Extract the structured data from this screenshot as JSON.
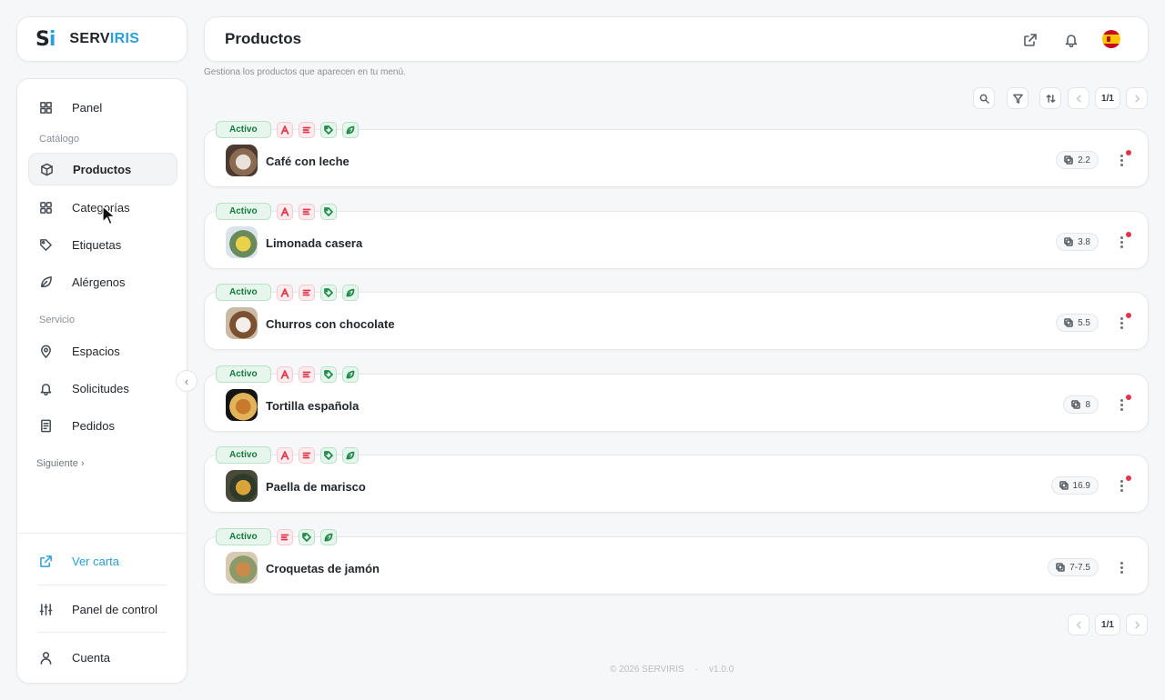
{
  "brand": {
    "mark_s": "S",
    "mark_i": "i",
    "name_a": "SERV",
    "name_b": "IRIS"
  },
  "sidebar": {
    "panel_label": "Panel",
    "catalog_section": "Catálogo",
    "catalog_items": [
      {
        "label": "Productos",
        "icon": "box-icon",
        "active": true
      },
      {
        "label": "Categorías",
        "icon": "grid-icon"
      },
      {
        "label": "Etiquetas",
        "icon": "tag-icon"
      },
      {
        "label": "Alérgenos",
        "icon": "leaf-icon"
      }
    ],
    "service_section": "Servicio",
    "service_items": [
      {
        "label": "Espacios",
        "icon": "map-pin-icon"
      },
      {
        "label": "Solicitudes",
        "icon": "bell-icon"
      },
      {
        "label": "Pedidos",
        "icon": "receipt-icon"
      }
    ],
    "next_label": "Siguiente",
    "ver_carta_label": "Ver carta",
    "control_panel_label": "Panel de control",
    "account_label": "Cuenta"
  },
  "header": {
    "title": "Productos",
    "subtitle": "Gestiona los productos que aparecen en tu menú.",
    "language": "es"
  },
  "pagination": {
    "top_label": "1/1",
    "bottom_label": "1/1"
  },
  "products": [
    {
      "name": "Café con leche",
      "status": "Activo",
      "price": "2.2",
      "chips": [
        "allergen-a-icon",
        "text-lines-icon",
        "tag-icon",
        "leaf-icon"
      ],
      "dot": true,
      "thumb_colors": [
        "#4a3a30",
        "#e8e2d8",
        "#8a6a50"
      ]
    },
    {
      "name": "Limonada casera",
      "status": "Activo",
      "price": "3.8",
      "chips": [
        "allergen-a-icon",
        "text-lines-icon",
        "tag-icon"
      ],
      "dot": true,
      "thumb_colors": [
        "#d9e3ea",
        "#e9d24a",
        "#6a8a5a"
      ]
    },
    {
      "name": "Churros con chocolate",
      "status": "Activo",
      "price": "5.5",
      "chips": [
        "allergen-a-icon",
        "text-lines-icon",
        "tag-icon",
        "leaf-icon"
      ],
      "dot": true,
      "thumb_colors": [
        "#c9b9a5",
        "#f3efe8",
        "#7b5132"
      ]
    },
    {
      "name": "Tortilla española",
      "status": "Activo",
      "price": "8",
      "chips": [
        "allergen-a-icon",
        "text-lines-icon",
        "tag-icon",
        "leaf-icon"
      ],
      "dot": true,
      "thumb_colors": [
        "#141414",
        "#c77a2a",
        "#e2b35a"
      ]
    },
    {
      "name": "Paella de marisco",
      "status": "Activo",
      "price": "16.9",
      "chips": [
        "allergen-a-icon",
        "text-lines-icon",
        "tag-icon",
        "leaf-icon"
      ],
      "dot": true,
      "thumb_colors": [
        "#4a4a3a",
        "#d9a43a",
        "#2f3a2a"
      ]
    },
    {
      "name": "Croquetas de jamón",
      "status": "Activo",
      "price": "7-7.5",
      "chips": [
        "text-lines-icon",
        "tag-icon",
        "leaf-icon"
      ],
      "dot": false,
      "thumb_colors": [
        "#d8c9b3",
        "#c98a4a",
        "#8a9a6a"
      ]
    }
  ],
  "footer": {
    "copyright": "© 2026 SERVIRIS",
    "separator": "·",
    "version": "v1.0.0"
  },
  "colors": {
    "accent": "#2b9fd9",
    "active_green": "#147a3c",
    "allergen_red": "#e0394e",
    "notification_red": "#e6324b"
  }
}
